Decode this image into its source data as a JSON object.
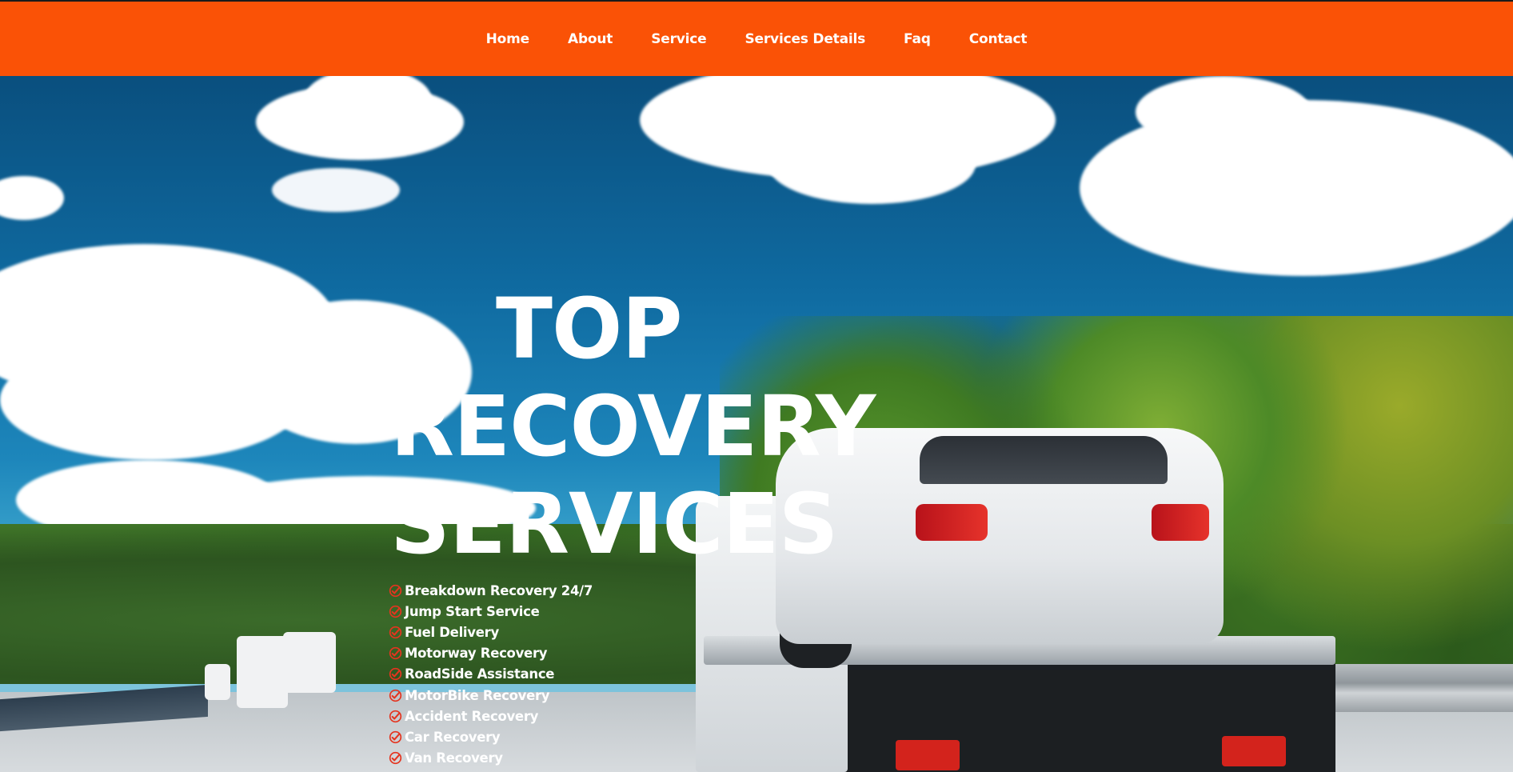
{
  "nav": {
    "items": [
      {
        "label": "Home"
      },
      {
        "label": "About"
      },
      {
        "label": "Service"
      },
      {
        "label": "Services Details"
      },
      {
        "label": "Faq"
      },
      {
        "label": "Contact"
      }
    ]
  },
  "hero": {
    "title_lines": [
      "TOP",
      "RECOVERY",
      "SERVICES"
    ],
    "services": [
      {
        "label": "Breakdown Recovery 24/7",
        "icon": "check-circle-icon"
      },
      {
        "label": "Jump Start Service",
        "icon": "check-circle-icon"
      },
      {
        "label": "Fuel Delivery",
        "icon": "check-circle-icon"
      },
      {
        "label": "Motorway Recovery",
        "icon": "check-circle-icon"
      },
      {
        "label": "RoadSide Assistance",
        "icon": "check-circle-icon"
      },
      {
        "label": "MotorBike Recovery",
        "icon": "check-circle-icon"
      },
      {
        "label": "Accident Recovery",
        "icon": "check-circle-icon"
      },
      {
        "label": "Car Recovery",
        "icon": "check-circle-icon"
      },
      {
        "label": "Van Recovery",
        "icon": "check-circle-icon"
      }
    ]
  },
  "colors": {
    "brand_orange": "#fa5206",
    "check_red": "#e5341f",
    "text": "#ffffff"
  }
}
